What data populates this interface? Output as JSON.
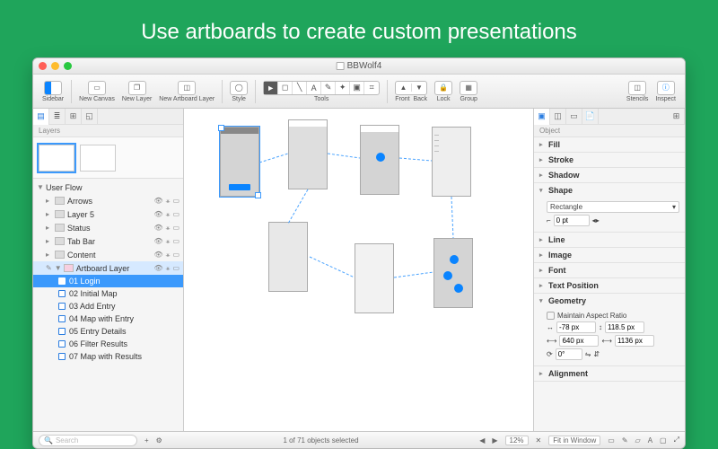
{
  "headline": "Use artboards to create custom presentations",
  "window": {
    "title": "BBWolf4"
  },
  "toolbar": {
    "sidebar": "Sidebar",
    "new_canvas": "New Canvas",
    "new_layer": "New Layer",
    "new_artboard_layer": "New Artboard Layer",
    "style": "Style",
    "tools": "Tools",
    "front": "Front",
    "back": "Back",
    "lock": "Lock",
    "group": "Group",
    "stencils": "Stencils",
    "inspect": "Inspect"
  },
  "sidebar": {
    "section_label": "Layers",
    "canvas_name": "User Flow",
    "layers": [
      {
        "label": "Arrows"
      },
      {
        "label": "Layer 5"
      },
      {
        "label": "Status"
      },
      {
        "label": "Tab Bar"
      },
      {
        "label": "Content"
      }
    ],
    "artboard_layer": "Artboard Layer",
    "artboards": [
      {
        "label": "01 Login",
        "selected": true
      },
      {
        "label": "02 Initial Map"
      },
      {
        "label": "03 Add Entry"
      },
      {
        "label": "04 Map with Entry"
      },
      {
        "label": "05 Entry Details"
      },
      {
        "label": "06 Filter Results"
      },
      {
        "label": "07 Map with Results"
      }
    ]
  },
  "inspector": {
    "header": "Object",
    "sections": {
      "fill": "Fill",
      "stroke": "Stroke",
      "shadow": "Shadow",
      "shape": "Shape",
      "line": "Line",
      "image": "Image",
      "font": "Font",
      "text_position": "Text Position",
      "geometry": "Geometry",
      "alignment": "Alignment"
    },
    "shape": {
      "type": "Rectangle",
      "corner_pt": "0 pt"
    },
    "geometry": {
      "aspect_label": "Maintain Aspect Ratio",
      "x": "-78 px",
      "y": "118.5 px",
      "w": "640 px",
      "h": "1136 px",
      "rot": "0°"
    }
  },
  "status": {
    "search_placeholder": "Search",
    "selection": "1 of 71 objects selected",
    "zoom": "12%",
    "fit": "Fit in Window"
  }
}
